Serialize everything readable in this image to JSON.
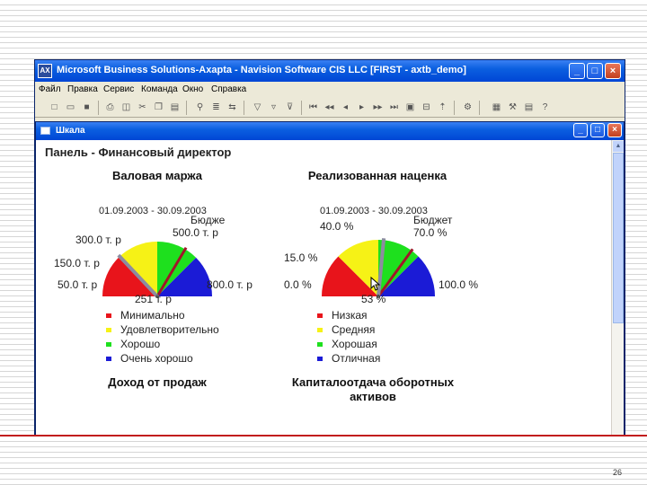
{
  "window": {
    "app_icon_text": "AX",
    "title": "Microsoft Business Solutions-Axapta - Navision Software CIS LLC [FIRST - axtb_demo]",
    "minimize": "_",
    "maximize": "□",
    "close": "×"
  },
  "menu": [
    "Файл",
    "Правка",
    "Сервис",
    "Команда",
    "Окно",
    "Справка"
  ],
  "doc_window": {
    "title": "Шкала"
  },
  "panel": {
    "title": "Панель - Финансовый директор"
  },
  "gauges": [
    {
      "title": "Валовая маржа",
      "date": "01.09.2003 - 30.09.2003",
      "labels": {
        "budget": "Бюдже",
        "budget_value": "500.0 т. р",
        "min": "50.0 т. р",
        "level1": "150.0 т. р",
        "level2": "300.0 т. р",
        "max": "800.0 т. р",
        "actual": "251 т. р"
      },
      "actual_fraction": 0.26,
      "budget_fraction": 0.67,
      "legend": [
        "Минимально",
        "Удовлетворительно",
        "Хорошо",
        "Очень хорошо"
      ]
    },
    {
      "title": "Реализованная наценка",
      "date": "01.09.2003 - 30.09.2003",
      "labels": {
        "budget": "Бюджет",
        "budget_value": "70.0 %",
        "min": "0.0 %",
        "level1": "15.0 %",
        "level2": "40.0 %",
        "max": "100.0 %",
        "actual": "53 %"
      },
      "actual_fraction": 0.53,
      "budget_fraction": 0.7,
      "legend": [
        "Низкая",
        "Средняя",
        "Хорошая",
        "Отличная"
      ]
    }
  ],
  "bottom": {
    "left_title": "Доход от продаж",
    "right_title": "Капиталоотдача оборотных активов"
  },
  "colors": {
    "red": "#e8141b",
    "yellow": "#f6f216",
    "green": "#1ee01e",
    "blue": "#1b1bd6",
    "budget_needle": "#a0162a",
    "actual_needle": "#8c8ca0"
  },
  "page_number": "26"
}
